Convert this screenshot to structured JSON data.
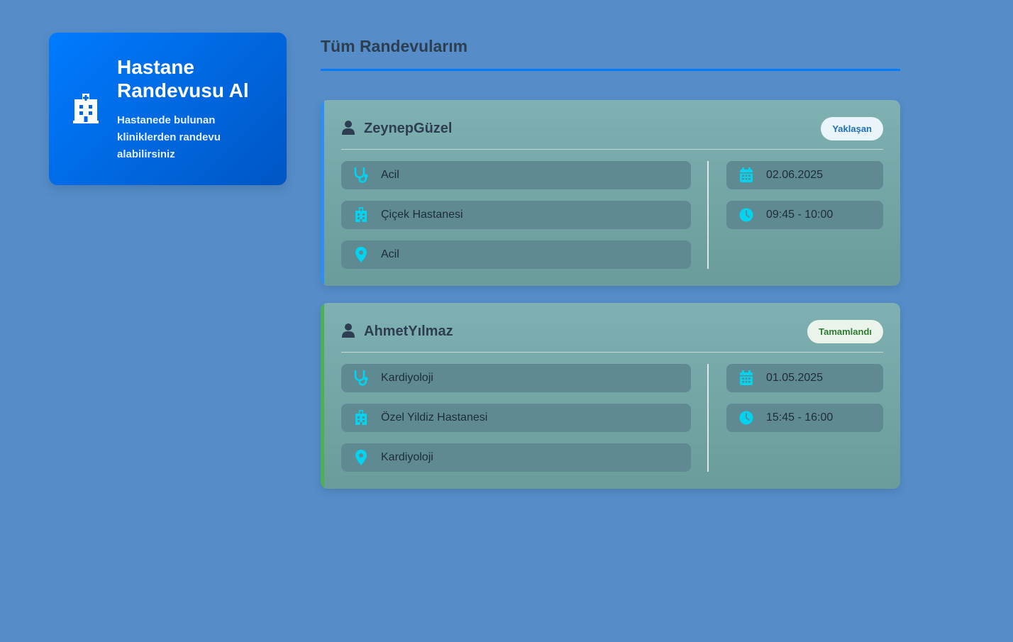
{
  "promo": {
    "title": "Hastane Randevusu Al",
    "description": "Hastanede bulunan kliniklerden randevu alabilirsiniz",
    "icon": "hospital-icon"
  },
  "section": {
    "title": "Tüm Randevularım"
  },
  "appointments": [
    {
      "patient": "ZeynepGüzel",
      "status": "Yaklaşan",
      "status_color": "#1f6fb8",
      "status_bg": "#eaf4fb",
      "accent_color": "#2f8ff0",
      "department": "Acil",
      "hospital": "Çiçek Hastanesi",
      "location": "Acil",
      "date": "02.06.2025",
      "time": "09:45 - 10:00"
    },
    {
      "patient": "AhmetYılmaz",
      "status": "Tamamlandı",
      "status_color": "#2e7d32",
      "status_bg": "#eaf4ea",
      "accent_color": "#4caf50",
      "department": "Kardiyoloji",
      "hospital": "Özel Yildiz Hastanesi",
      "location": "Kardiyoloji",
      "date": "01.05.2025",
      "time": "15:45 - 16:00"
    }
  ],
  "colors": {
    "background": "#568dc9",
    "primary": "#007bff",
    "icon_cyan": "#00d4f0"
  }
}
